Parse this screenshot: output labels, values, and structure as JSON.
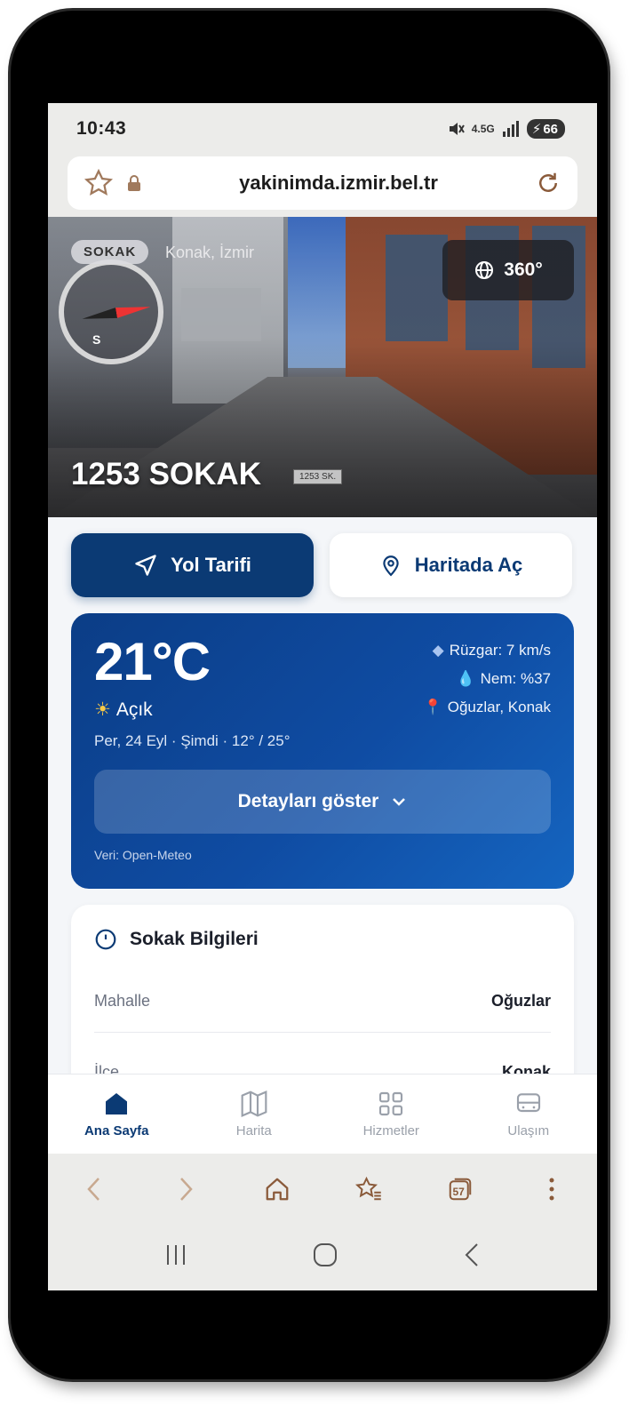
{
  "status": {
    "time": "10:43",
    "network": "4.5G",
    "battery": "66"
  },
  "browser": {
    "url": "yakinimda.izmir.bel.tr",
    "tabs_count": "57"
  },
  "hero": {
    "tag": "SOKAK",
    "location": "Konak, İzmir",
    "view_button": "360°",
    "street_sign_top": "1253 SK.",
    "title": "1253 SOKAK",
    "compass_label": "S"
  },
  "actions": {
    "directions": "Yol Tarifi",
    "open_map": "Haritada Aç"
  },
  "weather": {
    "temp": "21°C",
    "condition": "Açık",
    "date_line": "Per, 24 Eyl · Şimdi · 12° / 25°",
    "wind": "Rüzgar: 7 km/s",
    "humidity": "Nem: %37",
    "place": "Oğuzlar, Konak",
    "details_button": "Detayları göster",
    "source": "Veri: Open-Meteo"
  },
  "info": {
    "title": "Sokak Bilgileri",
    "rows": [
      {
        "key": "Mahalle",
        "value": "Oğuzlar"
      },
      {
        "key": "İlçe",
        "value": "Konak"
      }
    ]
  },
  "appnav": [
    {
      "label": "Ana Sayfa",
      "icon": "home-icon"
    },
    {
      "label": "Harita",
      "icon": "map-icon"
    },
    {
      "label": "Hizmetler",
      "icon": "grid-icon"
    },
    {
      "label": "Ulaşım",
      "icon": "bus-icon"
    }
  ]
}
